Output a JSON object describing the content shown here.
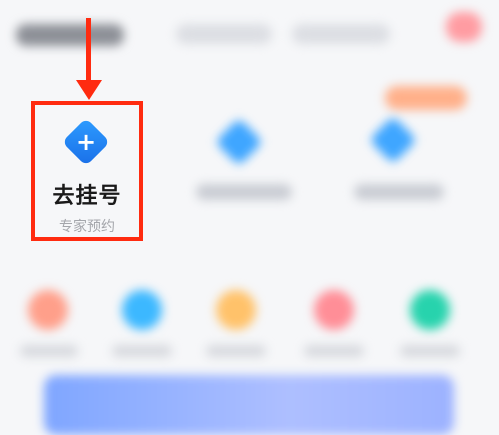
{
  "services": {
    "register": {
      "title": "去挂号",
      "subtitle": "专家预约",
      "icon": "plus-diamond-icon",
      "icon_color": "#1f86f5"
    }
  },
  "annotation": {
    "color": "#ff2b10"
  },
  "blurred_icons": [
    {
      "name": "service-icon-2",
      "color": "#3fa6ff"
    },
    {
      "name": "service-icon-3",
      "color": "#3fa6ff"
    }
  ],
  "quick_entries": [
    {
      "name": "quick-entry-1",
      "color": "#ff9f8a"
    },
    {
      "name": "quick-entry-2",
      "color": "#3cb8ff"
    },
    {
      "name": "quick-entry-3",
      "color": "#ffc26a"
    },
    {
      "name": "quick-entry-4",
      "color": "#ff8e97"
    },
    {
      "name": "quick-entry-5",
      "color": "#27d3ad"
    }
  ]
}
